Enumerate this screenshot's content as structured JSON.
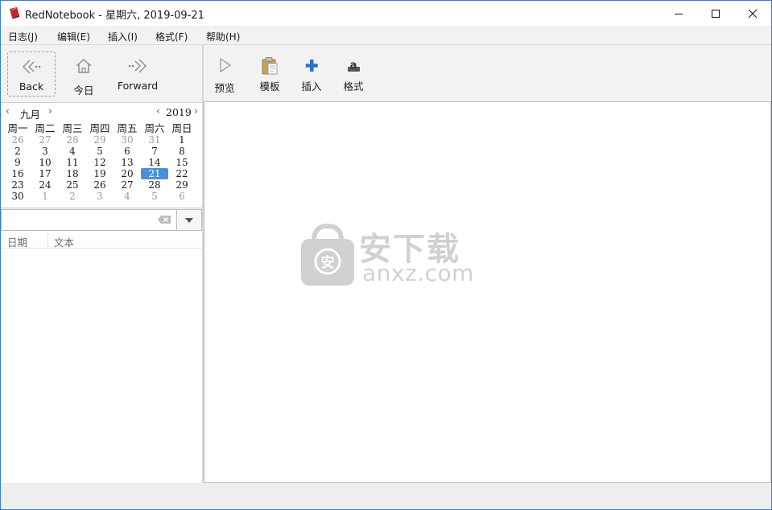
{
  "window": {
    "title": "RedNotebook - 星期六, 2019-09-21"
  },
  "menu": {
    "items": [
      "日志(J)",
      "编辑(E)",
      "插入(I)",
      "格式(F)",
      "帮助(H)"
    ]
  },
  "nav": {
    "back_label": "Back",
    "today_label": "今日",
    "forward_label": "Forward"
  },
  "toolbar": {
    "preview_label": "预览",
    "template_label": "模板",
    "insert_label": "插入",
    "format_label": "格式"
  },
  "calendar": {
    "month": "九月",
    "year": "2019",
    "weekdays": [
      "周一",
      "周二",
      "周三",
      "周四",
      "周五",
      "周六",
      "周日"
    ],
    "weeks": [
      [
        {
          "d": "26",
          "dim": true
        },
        {
          "d": "27",
          "dim": true
        },
        {
          "d": "28",
          "dim": true
        },
        {
          "d": "29",
          "dim": true
        },
        {
          "d": "30",
          "dim": true
        },
        {
          "d": "31",
          "dim": true
        },
        {
          "d": "1"
        }
      ],
      [
        {
          "d": "2"
        },
        {
          "d": "3"
        },
        {
          "d": "4"
        },
        {
          "d": "5"
        },
        {
          "d": "6"
        },
        {
          "d": "7"
        },
        {
          "d": "8"
        }
      ],
      [
        {
          "d": "9"
        },
        {
          "d": "10"
        },
        {
          "d": "11"
        },
        {
          "d": "12"
        },
        {
          "d": "13"
        },
        {
          "d": "14"
        },
        {
          "d": "15"
        }
      ],
      [
        {
          "d": "16"
        },
        {
          "d": "17"
        },
        {
          "d": "18"
        },
        {
          "d": "19"
        },
        {
          "d": "20"
        },
        {
          "d": "21",
          "sel": true
        },
        {
          "d": "22"
        }
      ],
      [
        {
          "d": "23"
        },
        {
          "d": "24"
        },
        {
          "d": "25"
        },
        {
          "d": "26"
        },
        {
          "d": "27"
        },
        {
          "d": "28"
        },
        {
          "d": "29"
        }
      ],
      [
        {
          "d": "30"
        },
        {
          "d": "1",
          "dim": true
        },
        {
          "d": "2",
          "dim": true
        },
        {
          "d": "3",
          "dim": true
        },
        {
          "d": "4",
          "dim": true
        },
        {
          "d": "5",
          "dim": true
        },
        {
          "d": "6",
          "dim": true
        }
      ]
    ],
    "selected_color": "#4a90d9"
  },
  "search": {
    "value": "",
    "placeholder": ""
  },
  "results": {
    "col_date": "日期",
    "col_text": "文本"
  },
  "watermark": {
    "cn": "安下载",
    "domain": "anxz.com"
  },
  "icons": {
    "app": "rednotebook-icon",
    "back": "back-arrow-icon",
    "today": "home-icon",
    "forward": "forward-arrow-icon",
    "preview": "play-icon",
    "template": "clipboard-icon",
    "insert": "plus-icon",
    "format": "format-icon"
  }
}
